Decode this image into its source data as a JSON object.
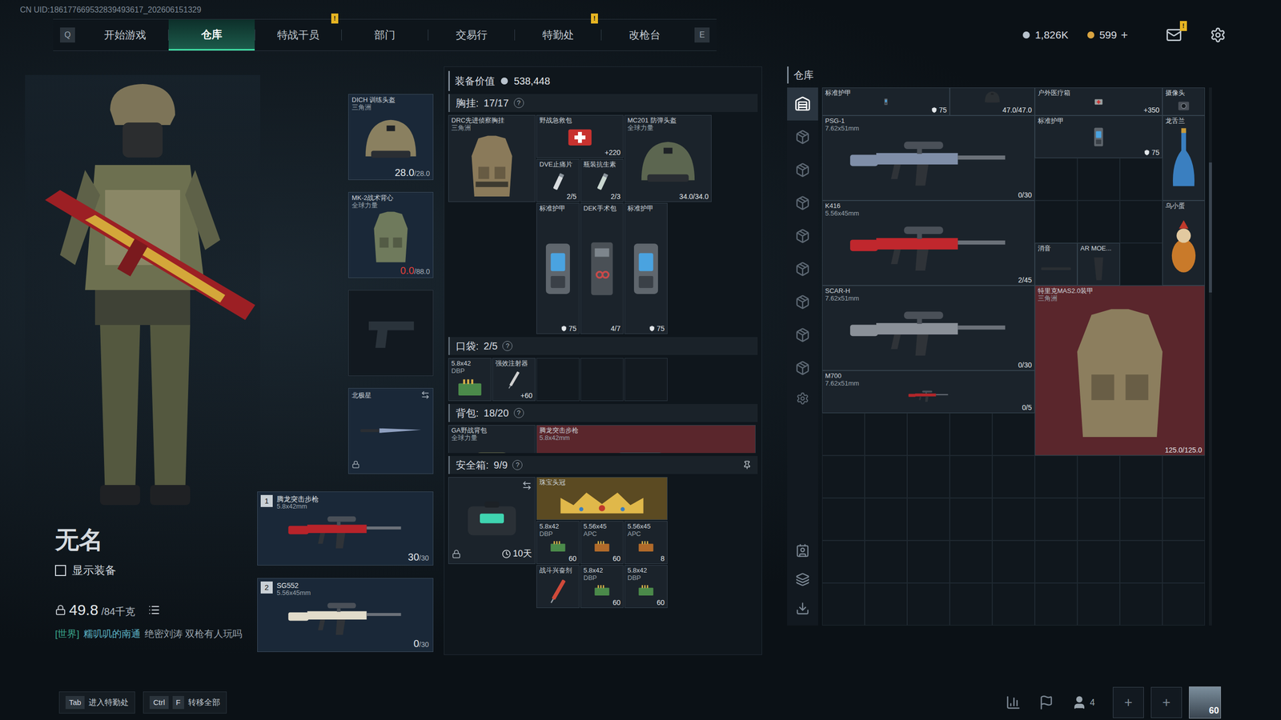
{
  "topbar": {
    "uid": "CN UID:186177669532839493617_202606151329",
    "prev_key": "Q",
    "next_key": "E",
    "tabs": [
      {
        "label": "开始游戏",
        "selected": false,
        "badge": ""
      },
      {
        "label": "仓库",
        "selected": true,
        "badge": ""
      },
      {
        "label": "特战干员",
        "selected": false,
        "badge": "!"
      },
      {
        "label": "部门",
        "selected": false,
        "badge": ""
      },
      {
        "label": "交易行",
        "selected": false,
        "badge": ""
      },
      {
        "label": "特勤处",
        "selected": false,
        "badge": "!"
      },
      {
        "label": "改枪台",
        "selected": false,
        "badge": ""
      }
    ],
    "currencies": [
      {
        "value": "1,826K",
        "plus": "",
        "color": "#b8c2cc"
      },
      {
        "value": "599",
        "plus": "+",
        "color": "#d9a441"
      }
    ],
    "mail_badge": "!"
  },
  "operator": {
    "name": "无名",
    "show_gear": {
      "label": "显示装备",
      "checked": false
    },
    "weight": "49.8",
    "weight_max": "/84千克",
    "chat": {
      "channel": "[世界]",
      "user": "糯叽叽的南通",
      "message": "绝密刘涛 双枪有人玩吗"
    }
  },
  "equipment": {
    "helmet": {
      "name": "DICH 训练头盔",
      "sub": "三角洲",
      "stat": "28.0",
      "stat_max": "/28.0",
      "broken": false,
      "kind": "helmet",
      "color": "#8a8060"
    },
    "armor": {
      "name": "MK-2战术背心",
      "sub": "全球力量",
      "stat": "0.0",
      "stat_max": "/88.0",
      "broken": true,
      "kind": "vest",
      "color": "#6f7a5c"
    },
    "pistol": {
      "filled": false
    },
    "melee": {
      "name": "北极星",
      "locked": true,
      "kind": "knife",
      "color": "#8fa0c0"
    },
    "weapons": [
      {
        "slot": "1",
        "name": "腾龙突击步枪",
        "sub": "5.8x42mm",
        "stat": "30",
        "stat_max": "/30",
        "color": "#b8232a"
      },
      {
        "slot": "2",
        "name": "SG552",
        "sub": "5.56x45mm",
        "stat": "0",
        "stat_max": "/30",
        "color": "#e2dccb"
      }
    ]
  },
  "loadout": {
    "value_label": "装备价值",
    "value": "538,448",
    "chest": {
      "label": "胸挂:",
      "count": "17/17",
      "help": "?",
      "items": [
        {
          "name": "DRC先进侦察胸挂",
          "sub": "三角洲",
          "stat": "",
          "kind": "rig",
          "color": "#8a7a5a",
          "rarity": "none"
        },
        {
          "name": "野战急救包",
          "sub": "",
          "stat": "+220",
          "kind": "med",
          "color": "#c8322f",
          "rarity": "none"
        },
        {
          "name": "DVE止痛片",
          "sub": "",
          "stat": "2/5",
          "kind": "pill",
          "color": "#d8dcdf",
          "rarity": "none"
        },
        {
          "name": "瓶装抗生素",
          "sub": "",
          "stat": "2/3",
          "kind": "pill",
          "color": "#c9d6d0",
          "rarity": "none"
        },
        {
          "name": "MC201 防弹头盔",
          "sub": "全球力量",
          "stat": "34.0/34.0",
          "kind": "helmet",
          "color": "#5c6650",
          "rarity": "none"
        },
        {
          "name": "标准护甲",
          "sub": "",
          "stat": "75",
          "kind": "plate",
          "color": "#5f666d",
          "rarity": "none"
        },
        {
          "name": "DEK手术包",
          "sub": "",
          "stat": "4/7",
          "kind": "kit",
          "color": "#4a5056",
          "rarity": "none"
        },
        {
          "name": "标准护甲",
          "sub": "",
          "stat": "75",
          "kind": "plate",
          "color": "#5f666d",
          "rarity": "none"
        }
      ]
    },
    "pockets": {
      "label": "口袋:",
      "count": "2/5",
      "help": "?",
      "items": [
        {
          "name": "5.8x42",
          "sub": "DBP",
          "stat": "",
          "kind": "ammo",
          "color": "#4b8a4a",
          "rarity": "none"
        },
        {
          "name": "强效注射器",
          "sub": "",
          "stat": "+60",
          "kind": "syringe",
          "color": "#d0d0d0",
          "rarity": "none"
        },
        {
          "kind": "empty"
        },
        {
          "kind": "empty"
        },
        {
          "kind": "empty"
        }
      ]
    },
    "backpack": {
      "label": "背包:",
      "count": "18/20",
      "help": "?",
      "items": [
        {
          "name": "GA野战背包",
          "sub": "全球力量",
          "stat": "",
          "kind": "bag",
          "color": "#5d6248",
          "rarity": "none"
        },
        {
          "name": "腾龙突击步枪",
          "sub": "5.8x42mm",
          "stat": "",
          "kind": "gun",
          "color": "#b8232a",
          "rarity": "red"
        }
      ]
    },
    "safe": {
      "label": "安全箱:",
      "count": "9/9",
      "help": "?",
      "case": {
        "days": "10天",
        "locked": true
      },
      "items": [
        {
          "name": "珠宝头冠",
          "sub": "",
          "stat": "",
          "kind": "crown",
          "color": "#e0b84a",
          "rarity": "gold"
        },
        {
          "name": "5.8x42",
          "sub": "DBP",
          "stat": "60",
          "kind": "ammo",
          "color": "#4b8a4a",
          "rarity": "none"
        },
        {
          "name": "5.56x45",
          "sub": "APC",
          "stat": "60",
          "kind": "ammo",
          "color": "#b06a2a",
          "rarity": "none"
        },
        {
          "name": "5.56x45",
          "sub": "APC",
          "stat": "8",
          "kind": "ammo",
          "color": "#b06a2a",
          "rarity": "none"
        },
        {
          "name": "战斗兴奋剂",
          "sub": "",
          "stat": "",
          "kind": "syringe",
          "color": "#d04a3a",
          "rarity": "none"
        },
        {
          "name": "5.8x42",
          "sub": "DBP",
          "stat": "60",
          "kind": "ammo",
          "color": "#4b8a4a",
          "rarity": "none"
        },
        {
          "name": "5.8x42",
          "sub": "DBP",
          "stat": "60",
          "kind": "ammo",
          "color": "#4b8a4a",
          "rarity": "none"
        }
      ]
    }
  },
  "warehouse": {
    "title": "仓库",
    "tabs": [
      {
        "selected": true
      },
      {
        "selected": false
      },
      {
        "selected": false
      },
      {
        "selected": false
      },
      {
        "selected": false
      },
      {
        "selected": false
      },
      {
        "selected": false
      },
      {
        "selected": false
      },
      {
        "selected": false
      }
    ],
    "items": [
      {
        "name": "标准护甲",
        "sub": "",
        "stat": "75",
        "kind": "plate",
        "color": "#5f666d",
        "rarity": "none"
      },
      {
        "name": "",
        "sub": "",
        "stat": "47.0/47.0",
        "kind": "helmet",
        "color": "#2a2f33",
        "rarity": "none"
      },
      {
        "name": "户外医疗箱",
        "sub": "",
        "stat": "+350",
        "kind": "medbox",
        "color": "#9aa0a0",
        "rarity": "none"
      },
      {
        "name": "摄像头",
        "sub": "",
        "stat": "",
        "kind": "camera",
        "color": "#3a3f45",
        "rarity": "none"
      },
      {
        "name": "PSG-1",
        "sub": "7.62x51mm",
        "stat": "0/30",
        "kind": "gun",
        "color": "#7f8ea8",
        "rarity": "none"
      },
      {
        "name": "标准护甲",
        "sub": "",
        "stat": "75",
        "kind": "plate",
        "color": "#5f666d",
        "rarity": "none"
      },
      {
        "name": "龙舌兰",
        "sub": "",
        "stat": "",
        "kind": "bottle",
        "color": "#3a7fc0",
        "rarity": "none"
      },
      {
        "name": "K416",
        "sub": "5.56x45mm",
        "stat": "2/45",
        "kind": "gun",
        "color": "#c0272d",
        "rarity": "none"
      },
      {
        "name": "消音",
        "sub": "",
        "stat": "",
        "kind": "part",
        "color": "#3a3f45",
        "rarity": "none"
      },
      {
        "name": "AR MOE...",
        "sub": "",
        "stat": "",
        "kind": "grip",
        "color": "#3a3f45",
        "rarity": "none"
      },
      {
        "name": "乌小蛋",
        "sub": "",
        "stat": "",
        "kind": "figure",
        "color": "#c97a2a",
        "rarity": "none"
      },
      {
        "name": "SCAR-H",
        "sub": "7.62x51mm",
        "stat": "0/30",
        "kind": "gun",
        "color": "#8a9098",
        "rarity": "none"
      },
      {
        "name": "特里克MAS2.0装甲",
        "sub": "三角洲",
        "stat": "125.0/125.0",
        "kind": "vest",
        "color": "#8c7e5e",
        "rarity": "red"
      },
      {
        "name": "M700",
        "sub": "7.62x51mm",
        "stat": "0/5",
        "kind": "gun",
        "color": "#b0262a",
        "rarity": "none"
      }
    ]
  },
  "bottom_bar": {
    "hints": [
      {
        "keys": [
          "Tab"
        ],
        "label": "进入特勤处"
      },
      {
        "keys": [
          "Ctrl",
          "F"
        ],
        "label": "转移全部"
      }
    ],
    "friends": "4",
    "slots": [
      "+",
      "+"
    ],
    "level": "60"
  }
}
